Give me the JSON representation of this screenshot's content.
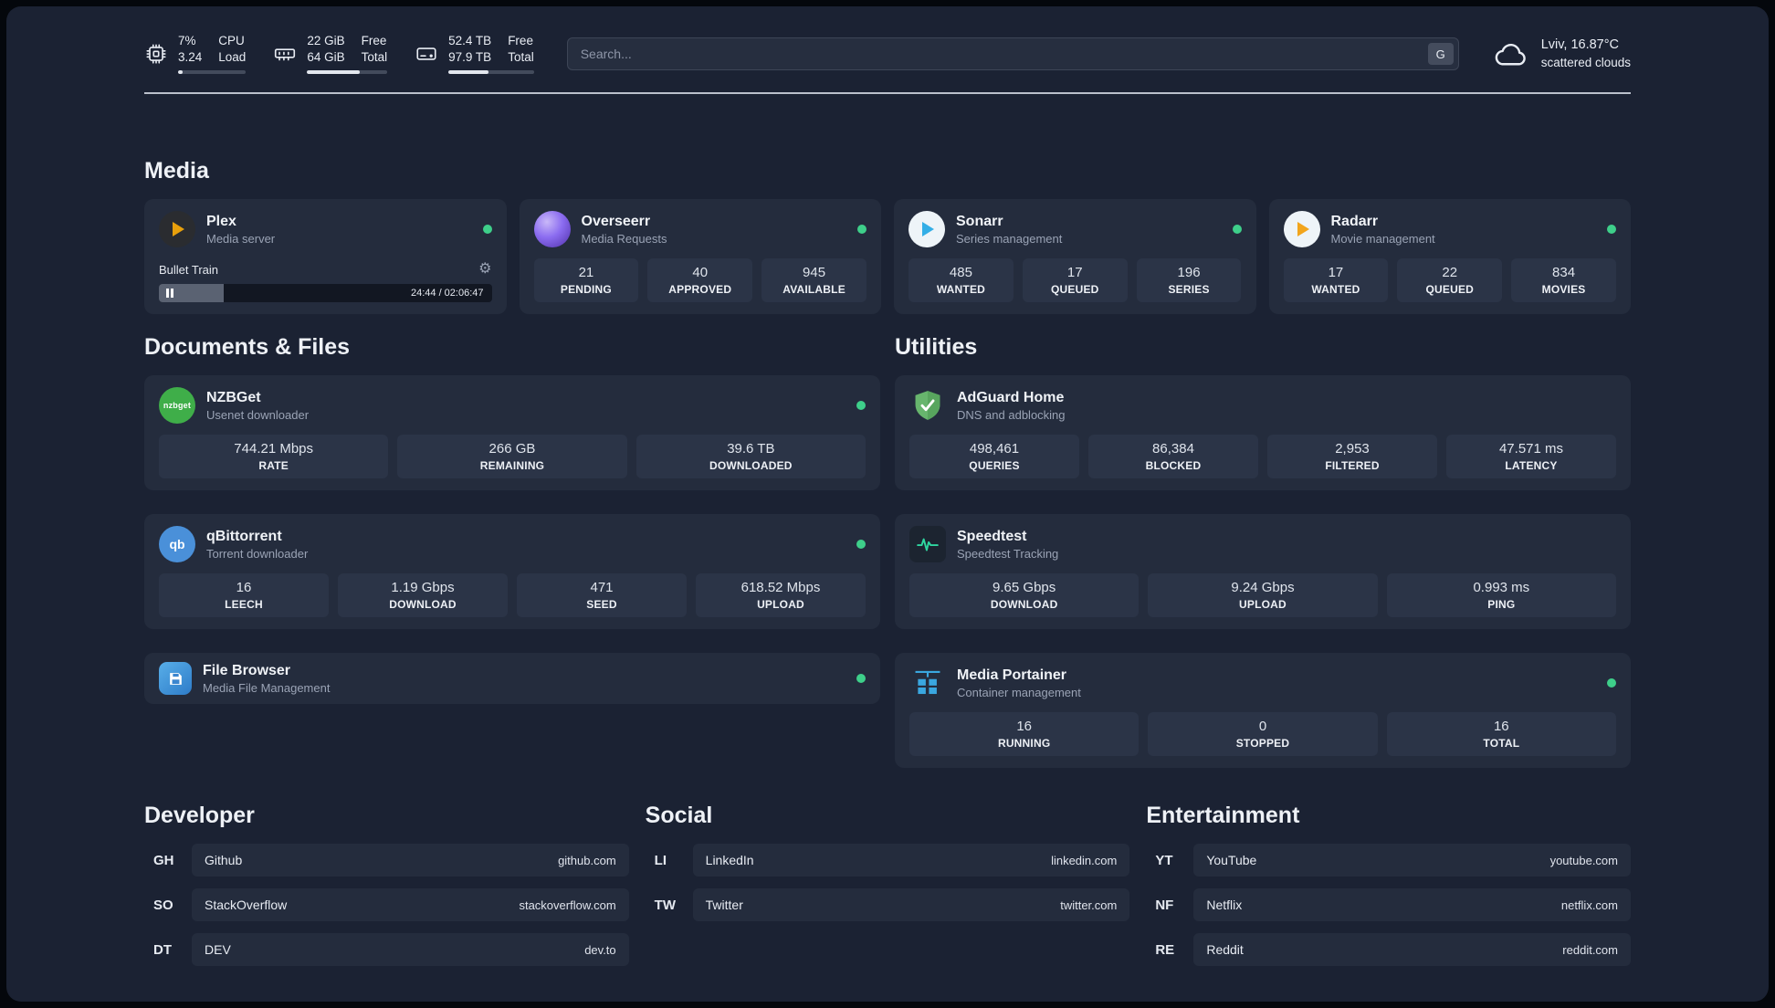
{
  "theme": {
    "background": "#1b2233",
    "card": "#242c3d",
    "tile": "#2b3447",
    "status_online": "#3ecf8a",
    "accent_plex": "#e8a00c",
    "accent_sonarr": "#33aee6",
    "accent_radarr": "#f2a51c",
    "accent_adguard": "#67b56d",
    "accent_speedtest": "#2fd6a0",
    "accent_portainer": "#3aa7e0"
  },
  "topbar": {
    "cpu": {
      "rows": [
        {
          "value": "7%",
          "label": "CPU"
        },
        {
          "value": "3.24",
          "label": "Load"
        }
      ],
      "percent": 7
    },
    "ram": {
      "rows": [
        {
          "value": "22 GiB",
          "label": "Free"
        },
        {
          "value": "64 GiB",
          "label": "Total"
        }
      ],
      "percent": 66
    },
    "disk": {
      "rows": [
        {
          "value": "52.4 TB",
          "label": "Free"
        },
        {
          "value": "97.9 TB",
          "label": "Total"
        }
      ],
      "percent": 47
    },
    "search": {
      "placeholder": "Search...",
      "shortcut": "G"
    },
    "weather": {
      "location": "Lviv, 16.87°C",
      "condition": "scattered clouds"
    }
  },
  "sections": {
    "media": {
      "title": "Media",
      "plex": {
        "name": "Plex",
        "subtitle": "Media server",
        "now_playing": "Bullet Train",
        "time": "24:44 / 02:06:47",
        "progress_percent": 19.5
      },
      "overseerr": {
        "name": "Overseerr",
        "subtitle": "Media Requests",
        "stats": [
          {
            "value": "21",
            "label": "PENDING"
          },
          {
            "value": "40",
            "label": "APPROVED"
          },
          {
            "value": "945",
            "label": "AVAILABLE"
          }
        ]
      },
      "sonarr": {
        "name": "Sonarr",
        "subtitle": "Series management",
        "stats": [
          {
            "value": "485",
            "label": "WANTED"
          },
          {
            "value": "17",
            "label": "QUEUED"
          },
          {
            "value": "196",
            "label": "SERIES"
          }
        ]
      },
      "radarr": {
        "name": "Radarr",
        "subtitle": "Movie management",
        "stats": [
          {
            "value": "17",
            "label": "WANTED"
          },
          {
            "value": "22",
            "label": "QUEUED"
          },
          {
            "value": "834",
            "label": "MOVIES"
          }
        ]
      }
    },
    "documents": {
      "title": "Documents & Files",
      "nzbget": {
        "name": "NZBGet",
        "subtitle": "Usenet downloader",
        "icon_text": "nzbget",
        "stats": [
          {
            "value": "744.21 Mbps",
            "label": "RATE"
          },
          {
            "value": "266 GB",
            "label": "REMAINING"
          },
          {
            "value": "39.6 TB",
            "label": "DOWNLOADED"
          }
        ]
      },
      "qbittorrent": {
        "name": "qBittorrent",
        "subtitle": "Torrent downloader",
        "icon_text": "qb",
        "stats": [
          {
            "value": "16",
            "label": "LEECH"
          },
          {
            "value": "1.19 Gbps",
            "label": "DOWNLOAD"
          },
          {
            "value": "471",
            "label": "SEED"
          },
          {
            "value": "618.52 Mbps",
            "label": "UPLOAD"
          }
        ]
      },
      "filebrowser": {
        "name": "File Browser",
        "subtitle": "Media File Management"
      }
    },
    "utilities": {
      "title": "Utilities",
      "adguard": {
        "name": "AdGuard Home",
        "subtitle": "DNS and adblocking",
        "stats": [
          {
            "value": "498,461",
            "label": "QUERIES"
          },
          {
            "value": "86,384",
            "label": "BLOCKED"
          },
          {
            "value": "2,953",
            "label": "FILTERED"
          },
          {
            "value": "47.571 ms",
            "label": "LATENCY"
          }
        ]
      },
      "speedtest": {
        "name": "Speedtest",
        "subtitle": "Speedtest Tracking",
        "stats": [
          {
            "value": "9.65 Gbps",
            "label": "DOWNLOAD"
          },
          {
            "value": "9.24 Gbps",
            "label": "UPLOAD"
          },
          {
            "value": "0.993 ms",
            "label": "PING"
          }
        ]
      },
      "portainer": {
        "name": "Media Portainer",
        "subtitle": "Container management",
        "stats": [
          {
            "value": "16",
            "label": "RUNNING"
          },
          {
            "value": "0",
            "label": "STOPPED"
          },
          {
            "value": "16",
            "label": "TOTAL"
          }
        ]
      }
    },
    "bookmarks": [
      {
        "title": "Developer",
        "items": [
          {
            "abbr": "GH",
            "name": "Github",
            "url": "github.com"
          },
          {
            "abbr": "SO",
            "name": "StackOverflow",
            "url": "stackoverflow.com"
          },
          {
            "abbr": "DT",
            "name": "DEV",
            "url": "dev.to"
          }
        ]
      },
      {
        "title": "Social",
        "items": [
          {
            "abbr": "LI",
            "name": "LinkedIn",
            "url": "linkedin.com"
          },
          {
            "abbr": "TW",
            "name": "Twitter",
            "url": "twitter.com"
          }
        ]
      },
      {
        "title": "Entertainment",
        "items": [
          {
            "abbr": "YT",
            "name": "YouTube",
            "url": "youtube.com"
          },
          {
            "abbr": "NF",
            "name": "Netflix",
            "url": "netflix.com"
          },
          {
            "abbr": "RE",
            "name": "Reddit",
            "url": "reddit.com"
          }
        ]
      }
    ]
  }
}
